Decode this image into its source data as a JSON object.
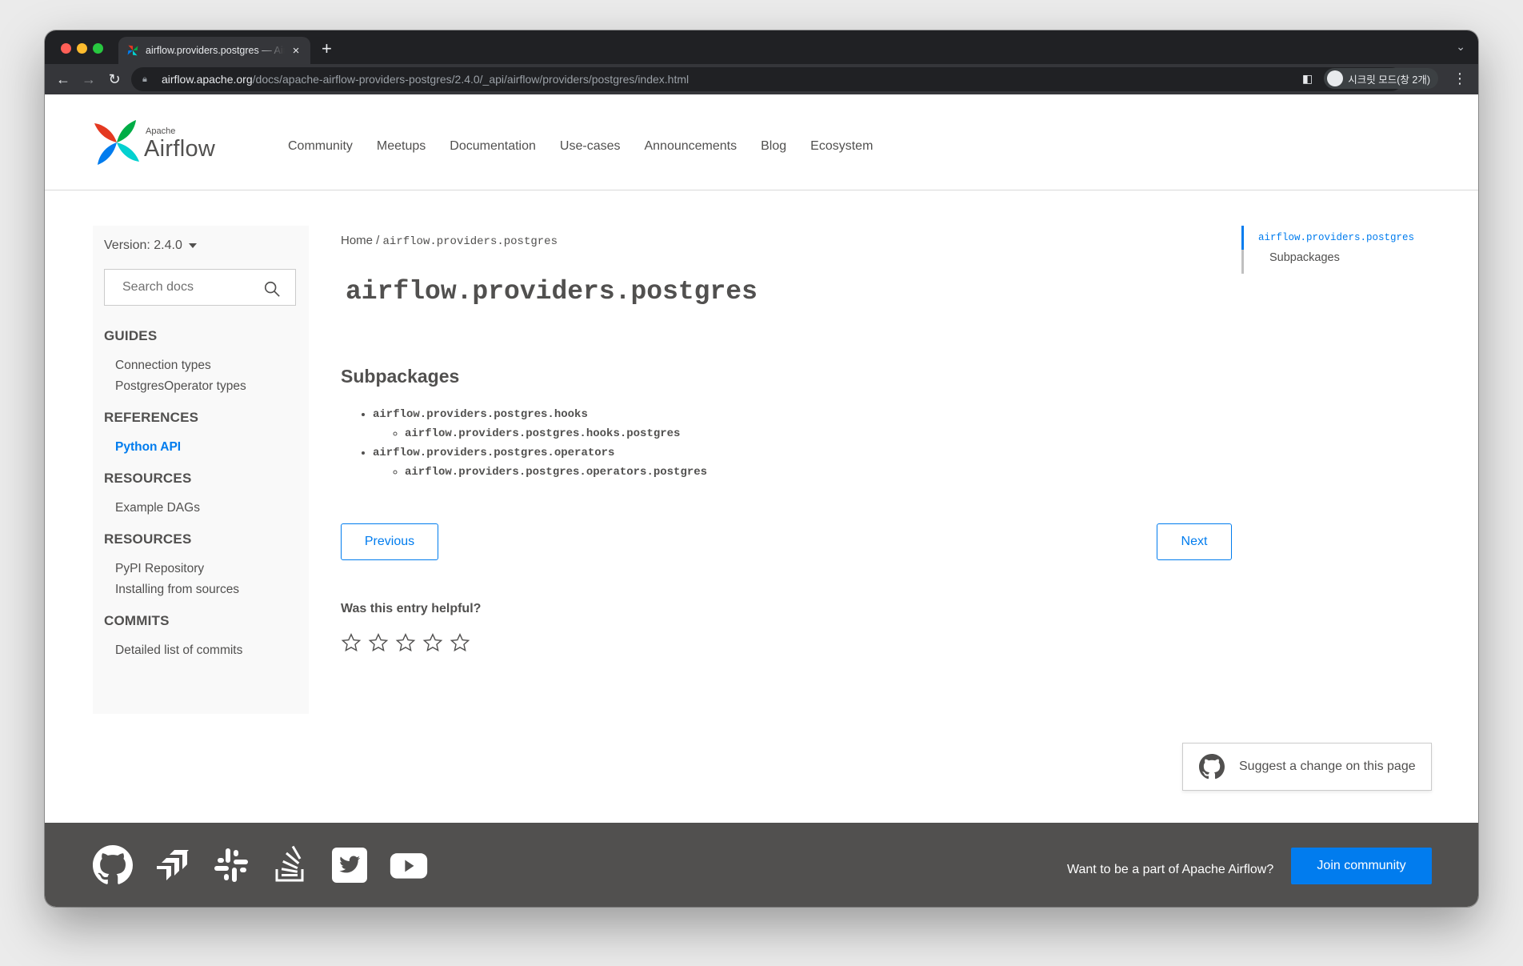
{
  "browser": {
    "tab_title": "airflow.providers.postgres — Airflow",
    "tab_close": "×",
    "new_tab": "+",
    "url_host": "airflow.apache.org",
    "url_path": "/docs/apache-airflow-providers-postgres/2.4.0/_api/airflow/providers/postgres/index.html",
    "incognito_label": "시크릿 모드(창 2개)"
  },
  "header": {
    "logo_small": "Apache",
    "logo_big": "Airflow",
    "nav": [
      "Community",
      "Meetups",
      "Documentation",
      "Use-cases",
      "Announcements",
      "Blog",
      "Ecosystem"
    ]
  },
  "sidebar": {
    "version": "Version: 2.4.0",
    "search_placeholder": "Search docs",
    "sections": [
      {
        "heading": "GUIDES",
        "links": [
          "Connection types",
          "PostgresOperator types"
        ]
      },
      {
        "heading": "REFERENCES",
        "links": [
          "Python API"
        ]
      },
      {
        "heading": "RESOURCES",
        "links": [
          "Example DAGs"
        ]
      },
      {
        "heading": "RESOURCES",
        "links": [
          "PyPI Repository",
          "Installing from sources"
        ]
      },
      {
        "heading": "COMMITS",
        "links": [
          "Detailed list of commits"
        ]
      }
    ]
  },
  "content": {
    "breadcrumb_home": "Home",
    "breadcrumb_sep": " / ",
    "breadcrumb_current": "airflow.providers.postgres",
    "title": "airflow.providers.postgres",
    "subpackages_heading": "Subpackages",
    "subpackages": [
      {
        "name": "airflow.providers.postgres.hooks",
        "children": [
          "airflow.providers.postgres.hooks.postgres"
        ]
      },
      {
        "name": "airflow.providers.postgres.operators",
        "children": [
          "airflow.providers.postgres.operators.postgres"
        ]
      }
    ],
    "prev_label": "Previous",
    "next_label": "Next",
    "helpful_label": "Was this entry helpful?",
    "rating": {
      "filled": 0,
      "max": 5
    }
  },
  "toc": {
    "items": [
      "airflow.providers.postgres",
      "Subpackages"
    ]
  },
  "suggest_label": "Suggest a change on this page",
  "footer": {
    "social_icons": [
      "github-icon",
      "jira-icon",
      "slack-icon",
      "stackoverflow-icon",
      "twitter-icon",
      "youtube-icon"
    ],
    "cta_text": "Want to be a part of Apache Airflow?",
    "join_label": "Join community"
  },
  "colors": {
    "accent": "#017cee",
    "text": "#51504f",
    "footer_bg": "#51504f"
  }
}
